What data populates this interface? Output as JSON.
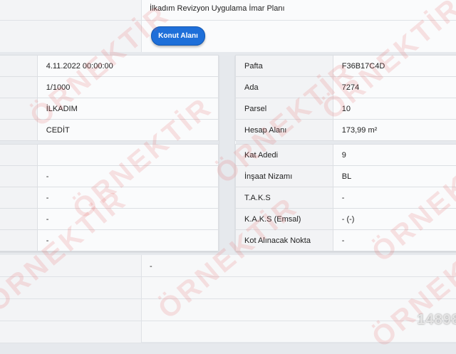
{
  "header": {
    "plan_name": "İlkadım Revizyon Uygulama İmar Planı",
    "button_label": "Konut Alanı"
  },
  "left_table": {
    "rows": [
      {
        "label": "",
        "value": "4.11.2022 00:00:00"
      },
      {
        "label": "",
        "value": "1/1000"
      },
      {
        "label": "",
        "value": "İLKADIM"
      },
      {
        "label": "",
        "value": "CEDİT"
      },
      {
        "label": "",
        "value": ""
      },
      {
        "label": "",
        "value": "-"
      },
      {
        "label": "",
        "value": "-"
      },
      {
        "label": "",
        "value": "-"
      },
      {
        "label": "",
        "value": "-"
      }
    ]
  },
  "right_table": {
    "rows": [
      {
        "label": "Pafta",
        "value": "F36B17C4D"
      },
      {
        "label": "Ada",
        "value": "7274"
      },
      {
        "label": "Parsel",
        "value": "10"
      },
      {
        "label": "Hesap Alanı",
        "value": "173,99 m²"
      },
      {
        "label": "Kat Adedi",
        "value": "9"
      },
      {
        "label": "İnşaat Nizamı",
        "value": "BL"
      },
      {
        "label": "T.A.K.S",
        "value": "-"
      },
      {
        "label": "K.A.K.S (Emsal)",
        "value": "- (-)"
      },
      {
        "label": "Kot Alınacak Nokta",
        "value": "-"
      }
    ]
  },
  "bottom_rows": [
    {
      "value": "-"
    },
    {
      "value": ""
    },
    {
      "value": ""
    },
    {
      "value": ""
    }
  ],
  "watermark": "ÖRNEKTİR",
  "listing_number": "14898"
}
